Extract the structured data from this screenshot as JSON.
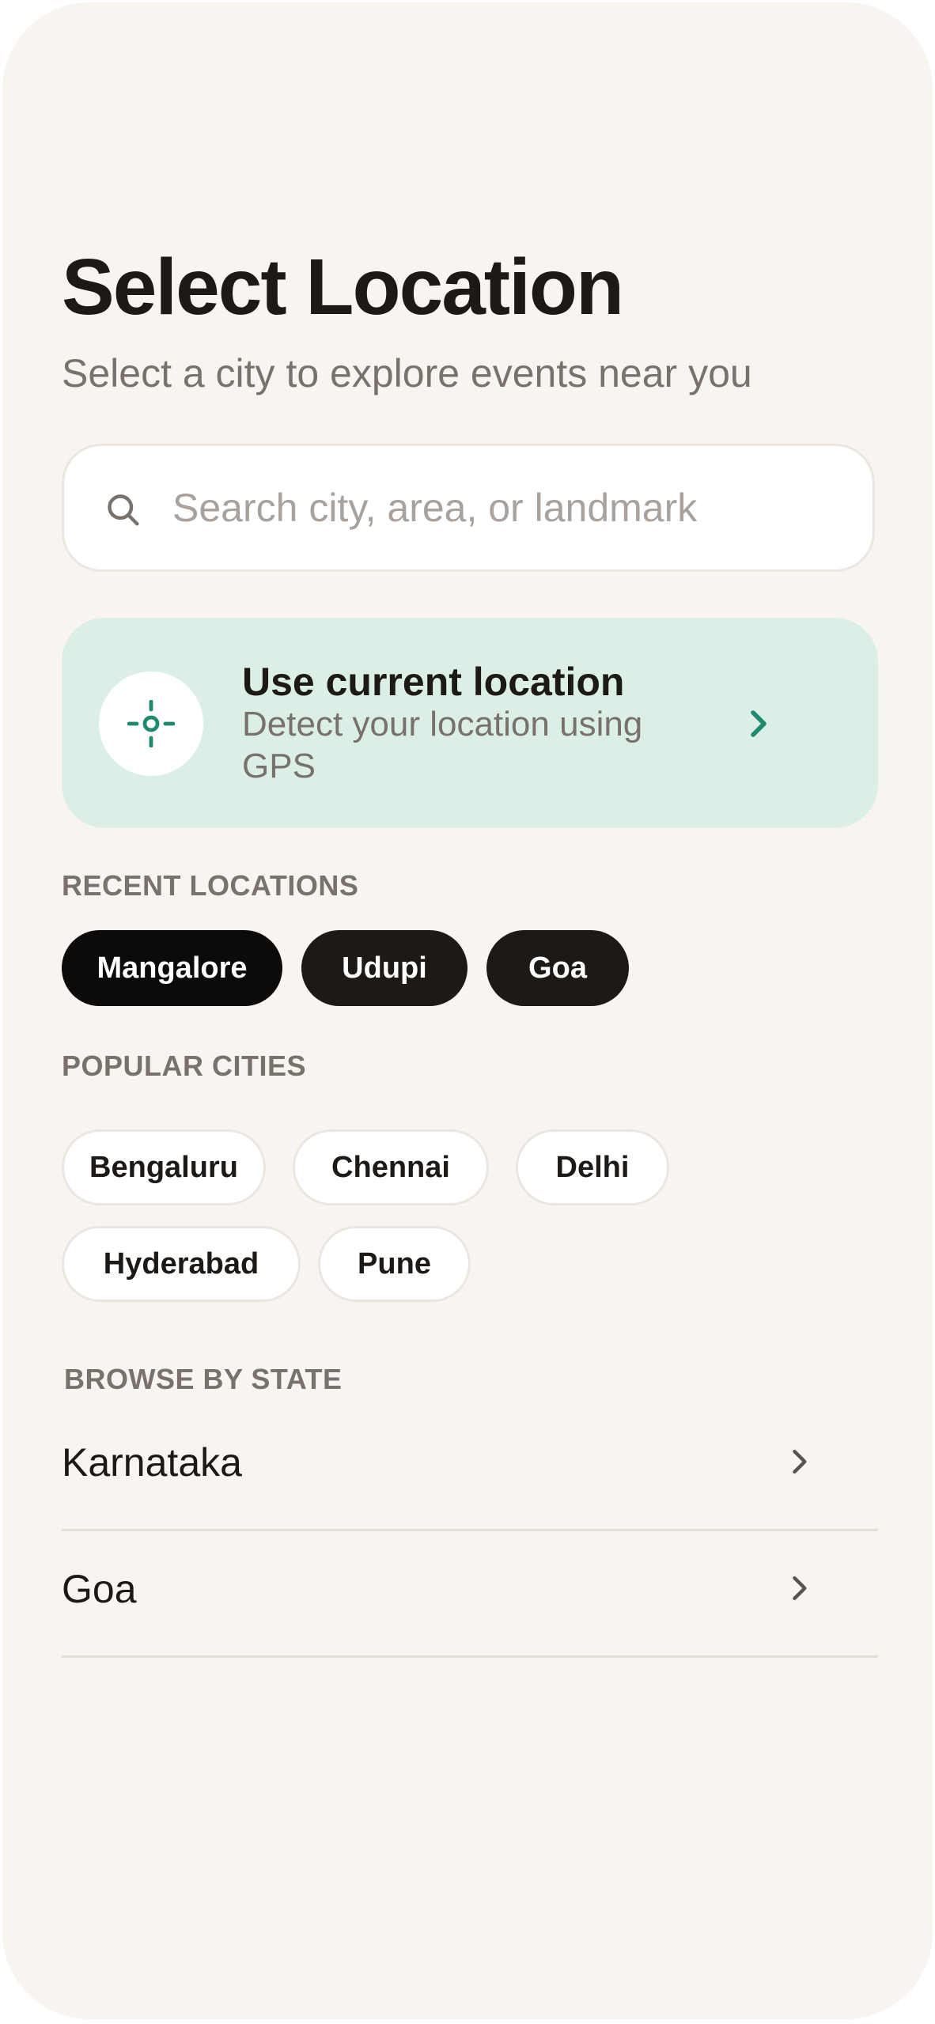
{
  "header": {
    "title": "Select Location",
    "subtitle": "Select a city to explore events near you"
  },
  "search": {
    "placeholder": "Search city, area, or landmark",
    "value": "",
    "icon": "search-icon"
  },
  "current_location": {
    "title": "Use current location",
    "description": "Detect your location using GPS",
    "icon": "crosshair-icon",
    "accent_color": "#1f8a6e",
    "background_color": "#dcefe6"
  },
  "recent": {
    "label": "RECENT LOCATIONS",
    "items": [
      "Mangalore",
      "Udupi",
      "Goa"
    ]
  },
  "popular": {
    "label": "POPULAR CITIES",
    "items": [
      "Bengaluru",
      "Chennai",
      "Delhi",
      "Hyderabad",
      "Pune"
    ]
  },
  "states": {
    "label": "BROWSE BY STATE",
    "items": [
      "Karnataka",
      "Goa"
    ]
  }
}
